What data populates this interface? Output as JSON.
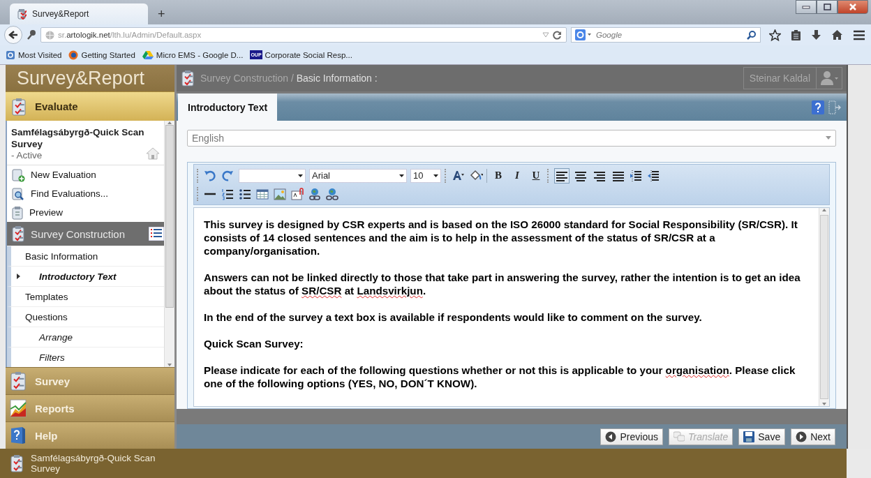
{
  "browser": {
    "tabs": [
      {
        "title": "Survey&Report",
        "selected": true
      }
    ],
    "new_tab": "+",
    "address": {
      "prefix": "sr.",
      "domain": "artologik.net",
      "path": "/lth.lu/Admin/Default.aspx"
    },
    "search": {
      "placeholder": "Google"
    },
    "bookmarks": [
      {
        "label": "Most Visited",
        "kind": "folder"
      },
      {
        "label": "Getting Started",
        "kind": "browser"
      },
      {
        "label": "Micro EMS - Google D...",
        "kind": "drive"
      },
      {
        "label": "Corporate Social Resp...",
        "kind": "oup",
        "badge": "OUP"
      }
    ]
  },
  "sidebar": {
    "brand": "Survey&Report",
    "evaluate": {
      "label": "Evaluate"
    },
    "survey_card": {
      "title": "Samfélagsábyrgð-Quick Scan Survey",
      "status": "- Active"
    },
    "items": [
      {
        "label": "New Evaluation",
        "kind": "action"
      },
      {
        "label": "Find Evaluations...",
        "kind": "action"
      },
      {
        "label": "Preview",
        "kind": "action"
      },
      {
        "label": "Survey Construction",
        "kind": "section",
        "selected": true
      },
      {
        "label": "Basic Information",
        "kind": "sub",
        "selected": false,
        "children": [
          {
            "label": "Introductory Text",
            "kind": "sub",
            "selected": true
          }
        ]
      },
      {
        "label": "Templates",
        "kind": "sub",
        "selected": false
      },
      {
        "label": "Questions",
        "kind": "sub",
        "selected": false,
        "children": [
          {
            "label": "Arrange",
            "kind": "sub",
            "selected": false
          },
          {
            "label": "Filters",
            "kind": "sub",
            "selected": false
          }
        ]
      }
    ],
    "sections": [
      {
        "label": "Survey"
      },
      {
        "label": "Reports"
      },
      {
        "label": "Help"
      }
    ]
  },
  "header": {
    "breadcrumb": {
      "parent": "Survey Construction",
      "separator": "/",
      "current": "Basic Information :"
    },
    "user": "Steinar Kaldal"
  },
  "tabs": [
    {
      "label": "Introductory Text",
      "selected": true
    }
  ],
  "language": {
    "value": "English"
  },
  "toolbar": {
    "rows": [
      [
        {
          "kind": "grip"
        },
        {
          "kind": "undo"
        },
        {
          "kind": "redo"
        },
        {
          "kind": "select"
        },
        {
          "kind": "select",
          "value": "Arial"
        },
        {
          "kind": "select",
          "value": "10"
        },
        {
          "kind": "grip"
        },
        {
          "kind": "font-color"
        },
        {
          "kind": "highlight"
        },
        {
          "kind": "sep"
        },
        {
          "kind": "toggle",
          "label": "B",
          "active": false
        },
        {
          "kind": "toggle",
          "label": "I",
          "active": false
        },
        {
          "kind": "toggle",
          "label": "U",
          "active": false
        },
        {
          "kind": "grip"
        },
        {
          "kind": "align",
          "active": true
        },
        {
          "kind": "align",
          "active": false
        },
        {
          "kind": "align",
          "active": false
        },
        {
          "kind": "align",
          "active": false
        },
        {
          "kind": "indent"
        },
        {
          "kind": "outdent"
        }
      ],
      [
        {
          "kind": "grip"
        },
        {
          "kind": "rule"
        },
        {
          "kind": "ordered-list"
        },
        {
          "kind": "bullet-list"
        },
        {
          "kind": "table"
        },
        {
          "kind": "image"
        },
        {
          "kind": "attach"
        },
        {
          "kind": "link"
        },
        {
          "kind": "unlink"
        }
      ]
    ]
  },
  "content": [
    [
      {
        "text": "This survey is designed by CSR experts and is based on the ISO 26000 standard for Social Responsibility (SR/CSR). It consists of 14 closed sentences and the aim is to help in the assessment of the status of SR/CSR at a company/organisation.",
        "misspelled": false
      }
    ],
    [
      {
        "text": "Answers can not be linked directly to those that take part in answering the survey, rather the intention is to get an idea about the status of ",
        "misspelled": false
      },
      {
        "text": "SR/CSR",
        "misspelled": true
      },
      {
        "text": " at ",
        "misspelled": false
      },
      {
        "text": "Landsvirkjun",
        "misspelled": true
      },
      {
        "text": ".",
        "misspelled": false
      }
    ],
    [
      {
        "text": "In the end of the survey a text box is available if respondents would like to comment on the survey.",
        "misspelled": false
      }
    ],
    [
      {
        "text": "Quick Scan Survey:",
        "misspelled": false
      }
    ],
    [
      {
        "text": "Please indicate for each of the following questions whether or not this is applicable to your ",
        "misspelled": false
      },
      {
        "text": "organisation",
        "misspelled": true
      },
      {
        "text": ". Please click one of the following options (YES, NO, DON´T KNOW).",
        "misspelled": false
      }
    ]
  ],
  "buttons": [
    {
      "label": "Previous",
      "kind": "previous",
      "disabled": false
    },
    {
      "label": "Translate",
      "kind": "translate",
      "disabled": true
    },
    {
      "label": "Save",
      "kind": "save",
      "disabled": false
    },
    {
      "label": "Next",
      "kind": "next",
      "disabled": false
    }
  ],
  "footer": {
    "title": "Samfélagsábyrgð-Quick Scan Survey"
  }
}
